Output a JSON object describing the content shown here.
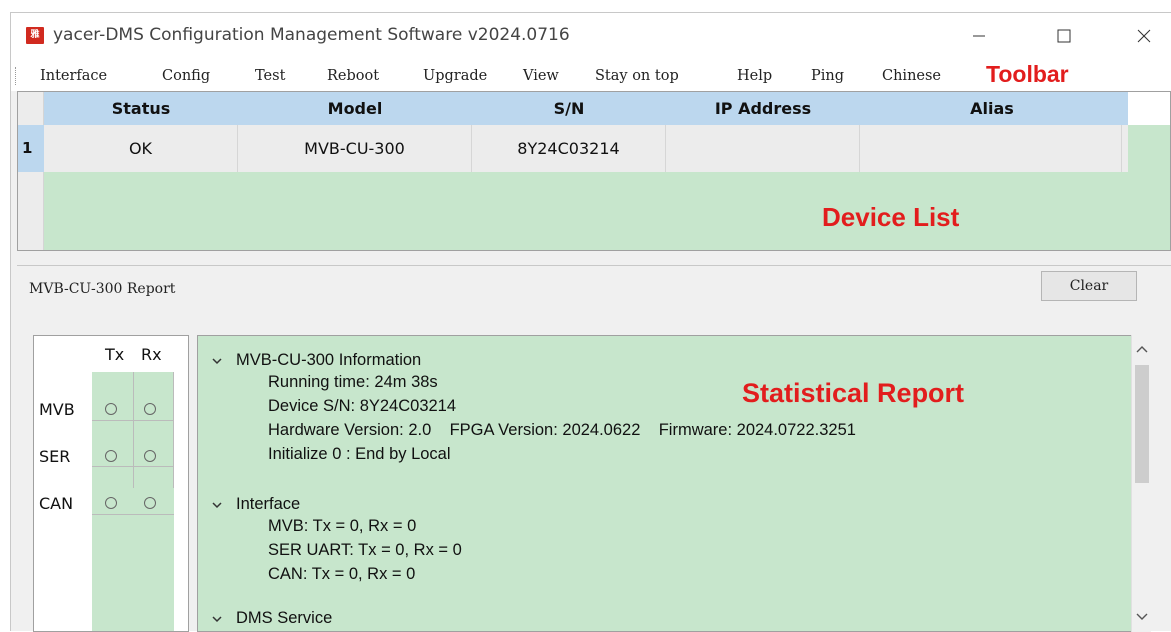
{
  "window": {
    "app_icon_text": "雅",
    "title": "yacer-DMS Configuration Management Software v2024.0716"
  },
  "menubar": {
    "items": [
      "Interface",
      "Config",
      "Test",
      "Reboot",
      "Upgrade",
      "View",
      "Stay on top",
      "Help",
      "Ping",
      "Chinese"
    ]
  },
  "annotations": {
    "toolbar": "Toolbar",
    "device_list": "Device List",
    "statistical_report": "Statistical Report"
  },
  "device_list": {
    "columns": [
      "Status",
      "Model",
      "S/N",
      "IP Address",
      "Alias"
    ],
    "rows": [
      {
        "index": "1",
        "status": "OK",
        "model": "MVB-CU-300",
        "sn": "8Y24C03214",
        "ip": "",
        "alias": ""
      }
    ]
  },
  "report": {
    "label": "MVB-CU-300 Report",
    "clear_label": "Clear"
  },
  "indicators": {
    "columns": [
      "Tx",
      "Rx"
    ],
    "rows": [
      "MVB",
      "SER",
      "CAN"
    ]
  },
  "tree": {
    "lines": [
      {
        "text": "MVB-CU-300 Information",
        "level": 0,
        "expanded": true
      },
      {
        "text": "Running time: 24m 38s",
        "level": 1
      },
      {
        "text": "Device S/N: 8Y24C03214",
        "level": 1
      },
      {
        "text": "Hardware Version: 2.0    FPGA Version: 2024.0622    Firmware: 2024.0722.3251",
        "level": 1
      },
      {
        "text": "Initialize 0 : End by Local",
        "level": 1
      },
      {
        "text": "Interface",
        "level": 0,
        "expanded": true
      },
      {
        "text": "MVB: Tx = 0, Rx = 0",
        "level": 1
      },
      {
        "text": "SER UART: Tx = 0, Rx = 0",
        "level": 1
      },
      {
        "text": "CAN: Tx = 0, Rx = 0",
        "level": 1
      },
      {
        "text": "DMS Service",
        "level": 0,
        "expanded": true
      }
    ]
  },
  "colors": {
    "accent_red": "#e21d1d",
    "list_green": "#c7e6cc",
    "header_blue": "#bcd7ee"
  }
}
